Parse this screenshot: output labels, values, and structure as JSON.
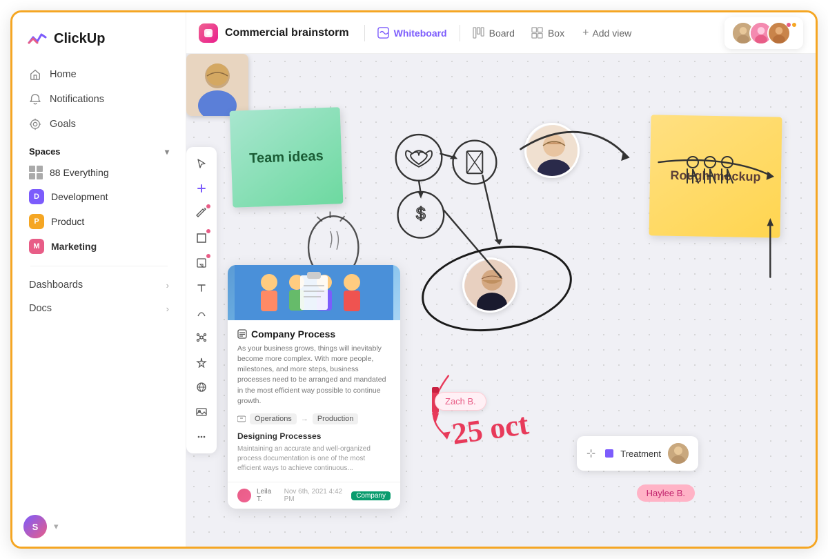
{
  "app": {
    "logo": "ClickUp",
    "logo_letter": "S"
  },
  "sidebar": {
    "nav": [
      {
        "id": "home",
        "label": "Home",
        "icon": "home"
      },
      {
        "id": "notifications",
        "label": "Notifications",
        "icon": "bell"
      },
      {
        "id": "goals",
        "label": "Goals",
        "icon": "trophy"
      }
    ],
    "spaces_section": "Spaces",
    "everything_label": "88 Everything",
    "spaces": [
      {
        "id": "development",
        "label": "Development",
        "letter": "D",
        "color_class": "dev"
      },
      {
        "id": "product",
        "label": "Product",
        "letter": "P",
        "color_class": "prod"
      },
      {
        "id": "marketing",
        "label": "Marketing",
        "letter": "M",
        "color_class": "mkt"
      }
    ],
    "dashboards_label": "Dashboards",
    "docs_label": "Docs"
  },
  "topbar": {
    "breadcrumb_title": "Commercial brainstorm",
    "tab_whiteboard": "Whiteboard",
    "tab_board": "Board",
    "tab_box": "Box",
    "add_view": "Add view"
  },
  "canvas": {
    "sticky_green_text": "Team ideas",
    "sticky_yellow_text": "Rough mockup",
    "doc_card": {
      "title": "Company Process",
      "description": "As your business grows, things will inevitably become more complex. With more people, milestones, and more steps, business processes need to be arranged and mandated in the most efficient way possible to continue growth.",
      "flow_from": "Operations",
      "flow_to": "Production",
      "section_title": "Designing Processes",
      "section_desc": "Maintaining an accurate and well-organized process documentation is one of the most efficient ways to achieve continuous...",
      "footer_name": "Leila T.",
      "footer_date": "Nov 6th, 2021 4:42 PM",
      "footer_badge": "Company"
    },
    "zach_label": "Zach B.",
    "haylee_label": "Haylee B.",
    "treatment_label": "Treatment",
    "date_text": "25 oct"
  },
  "draw_tools": [
    "cursor",
    "pencil",
    "rectangle",
    "sticky",
    "text",
    "zigzag",
    "network",
    "sparkle",
    "globe",
    "image",
    "more"
  ]
}
